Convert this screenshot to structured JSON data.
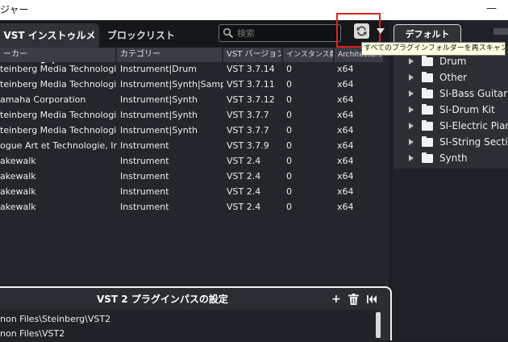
{
  "window": {
    "title": "ジャー",
    "minimize": "—"
  },
  "tabs": [
    {
      "label": "VST インストゥルメント"
    },
    {
      "label": "ブロックリスト"
    }
  ],
  "search": {
    "placeholder": "検索"
  },
  "tooltip": "すべてのプラグインフォルダーを再スキャン",
  "table": {
    "headers": [
      "ーカー",
      "カテゴリー",
      "VST バージョン",
      "インスタンス数",
      "Architecture"
    ],
    "rows": [
      [
        "teinberg Media Technologies",
        "Instrument|Drum",
        "VST 3.7.14",
        "0",
        "x64"
      ],
      [
        "teinberg Media Technologies",
        "Instrument|Synth|Sampler",
        "VST 3.7.11",
        "0",
        "x64"
      ],
      [
        "amaha Corporation",
        "Instrument|Synth",
        "VST 3.7.12",
        "0",
        "x64"
      ],
      [
        "teinberg Media Technologies",
        "Instrument|Synth",
        "VST 3.7.7",
        "0",
        "x64"
      ],
      [
        "teinberg Media Technologies",
        "Instrument|Synth",
        "VST 3.7.7",
        "0",
        "x64"
      ],
      [
        "ogue Art et Technologie, Inc",
        "Instrument",
        "VST 3.7.9",
        "0",
        "x64"
      ],
      [
        "akewalk",
        "Instrument",
        "VST 2.4",
        "0",
        "x64"
      ],
      [
        "akewalk",
        "Instrument",
        "VST 2.4",
        "0",
        "x64"
      ],
      [
        "akewalk",
        "Instrument",
        "VST 2.4",
        "0",
        "x64"
      ],
      [
        "akewalk",
        "Instrument",
        "VST 2.4",
        "0",
        "x64"
      ]
    ]
  },
  "vst2": {
    "title": "VST 2 プラグインパスの設定",
    "paths": [
      "non Files\\Steinberg\\VST2",
      "non Files\\VST2"
    ]
  },
  "preset": {
    "label": "デフォルト"
  },
  "tree": [
    "Drum",
    "Other",
    "SI-Bass Guitar",
    "SI-Drum Kit",
    "SI-Electric Piano",
    "SI-String Section",
    "Synth"
  ]
}
